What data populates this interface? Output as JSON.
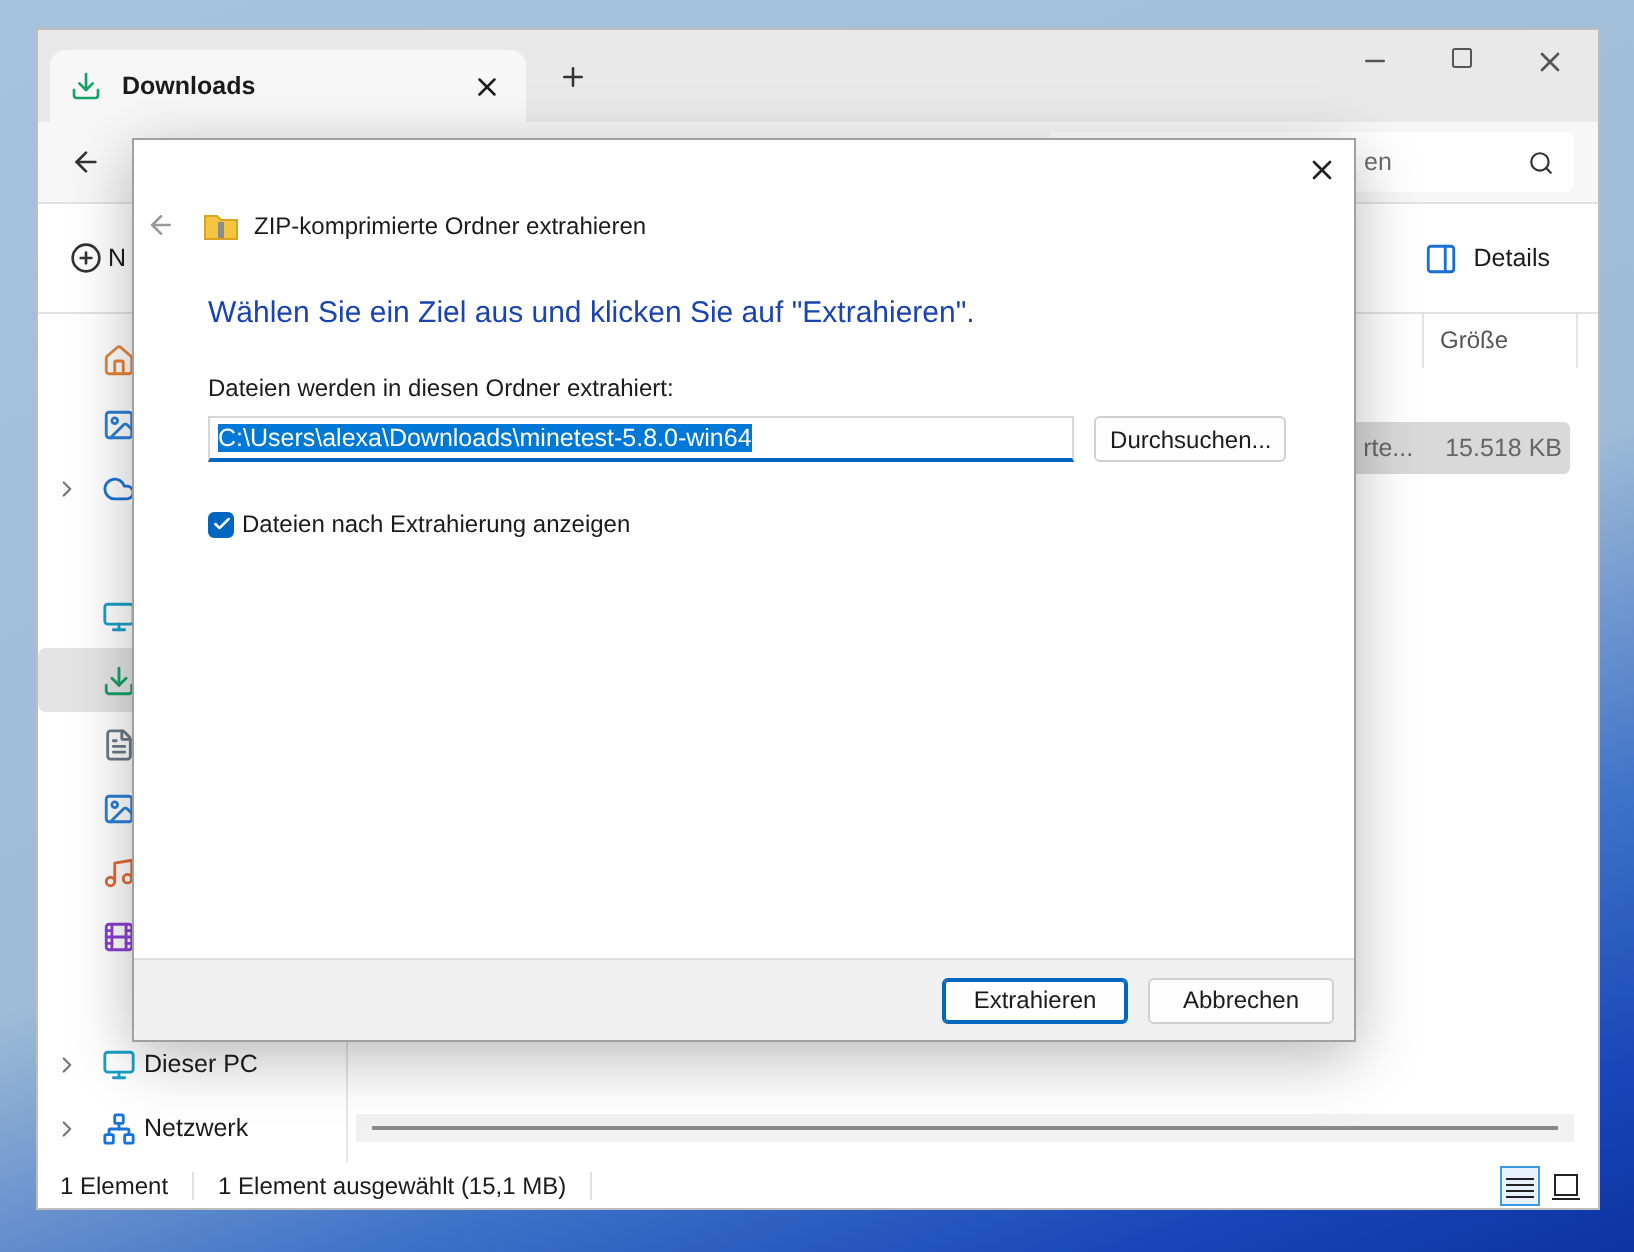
{
  "explorer": {
    "tab": {
      "title": "Downloads"
    },
    "search": {
      "placeholder": "en"
    },
    "toolbar": {
      "new_label": "N",
      "details_label": "Details"
    },
    "size_header": "Größe",
    "files": [
      {
        "name": "rte...",
        "size": "15.518 KB",
        "selected": true
      }
    ],
    "sidebar": {
      "items": [
        {
          "kind": "home",
          "selected": false,
          "expandable": false
        },
        {
          "kind": "gallery",
          "selected": false,
          "expandable": false
        },
        {
          "kind": "cloud",
          "selected": false,
          "expandable": true
        },
        {
          "kind": "divider"
        },
        {
          "kind": "desktop",
          "selected": false,
          "expandable": false
        },
        {
          "kind": "downloads",
          "selected": true,
          "expandable": false
        },
        {
          "kind": "documents",
          "selected": false,
          "expandable": false
        },
        {
          "kind": "pictures",
          "selected": false,
          "expandable": false
        },
        {
          "kind": "music",
          "selected": false,
          "expandable": false
        },
        {
          "kind": "videos",
          "selected": false,
          "expandable": false
        },
        {
          "kind": "divider"
        },
        {
          "kind": "pc",
          "label": "Dieser PC",
          "selected": false,
          "expandable": true
        },
        {
          "kind": "network",
          "label": "Netzwerk",
          "selected": false,
          "expandable": true
        }
      ]
    },
    "status_bar": {
      "count": "1 Element",
      "selection": "1 Element ausgewählt (15,1 MB)",
      "view_modes": [
        {
          "kind": "details",
          "selected": true
        },
        {
          "kind": "tiles",
          "selected": false
        }
      ]
    }
  },
  "dialog": {
    "title": "ZIP-komprimierte Ordner extrahieren",
    "heading": "Wählen Sie ein Ziel aus und klicken Sie auf \"Extrahieren\".",
    "path_label": "Dateien werden in diesen Ordner extrahiert:",
    "path": {
      "value": "C:\\Users\\alexa\\Downloads\\minetest-5.8.0-win64",
      "text_selected": true
    },
    "browse_button": "Durchsuchen...",
    "show_files": {
      "label": "Dateien nach Extrahierung anzeigen",
      "checked": true
    },
    "buttons": [
      {
        "label": "Extrahieren",
        "default": true
      },
      {
        "label": "Abbrechen",
        "default": false
      }
    ]
  }
}
